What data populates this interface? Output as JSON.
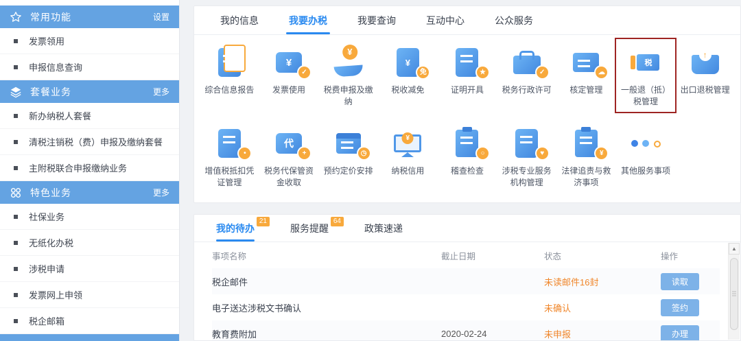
{
  "colors": {
    "section_header_blue": "#64a3e2",
    "active_tab_blue": "#2a8af0",
    "icon_blue": "#4f97e8",
    "icon_orange": "#f8a93c",
    "status_orange": "#f0862a",
    "button_blue": "#7db2e8",
    "highlight_box_red": "#9e2422"
  },
  "sidebar": {
    "sections": [
      {
        "title": "常用功能",
        "action": "设置",
        "icon": "star-icon",
        "items": [
          {
            "label": "发票领用"
          },
          {
            "label": "申报信息查询"
          }
        ]
      },
      {
        "title": "套餐业务",
        "action": "更多",
        "icon": "layers-icon",
        "items": [
          {
            "label": "新办纳税人套餐"
          },
          {
            "label": "清税注销税（费）申报及缴纳套餐"
          },
          {
            "label": "主附税联合申报缴纳业务"
          }
        ]
      },
      {
        "title": "特色业务",
        "action": "更多",
        "icon": "grid-dots-icon",
        "items": [
          {
            "label": "社保业务"
          },
          {
            "label": "无纸化办税"
          },
          {
            "label": "涉税申请"
          },
          {
            "label": "发票网上申领"
          },
          {
            "label": "税企邮箱"
          }
        ]
      }
    ]
  },
  "top_tabs": [
    {
      "label": "我的信息"
    },
    {
      "label": "我要办税",
      "active": true
    },
    {
      "label": "我要查询"
    },
    {
      "label": "互动中心"
    },
    {
      "label": "公众服务"
    }
  ],
  "grid": {
    "row1": [
      {
        "label": "综合信息报告",
        "icon": "stacked-documents-icon"
      },
      {
        "label": "发票使用",
        "icon": "invoice-check-icon",
        "glyph": "¥",
        "badge": "✓"
      },
      {
        "label": "税费申报及缴纳",
        "icon": "hand-coin-icon",
        "badge": "¥"
      },
      {
        "label": "税收减免",
        "icon": "tax-reduction-document-icon",
        "glyph": "¥",
        "badge": "免"
      },
      {
        "label": "证明开具",
        "icon": "certificate-star-icon",
        "badge": "★"
      },
      {
        "label": "税务行政许可",
        "icon": "briefcase-check-icon",
        "badge": "✓"
      },
      {
        "label": "核定管理",
        "icon": "server-cloud-icon",
        "badge": "☁"
      },
      {
        "label": "一般退（抵）税管理",
        "icon": "tax-ticket-icon",
        "glyph": "税",
        "highlighted": true
      },
      {
        "label": "出口退税管理",
        "icon": "export-box-icon",
        "glyph": "↑"
      }
    ],
    "row2": [
      {
        "label": "增值税抵扣凭证管理",
        "icon": "document-stamp-icon",
        "badge": "•"
      },
      {
        "label": "税务代保管资金收取",
        "icon": "agent-bubble-icon",
        "glyph": "代",
        "badge": "+"
      },
      {
        "label": "预约定价安排",
        "icon": "calendar-clock-icon",
        "badge": "◷"
      },
      {
        "label": "纳税信用",
        "icon": "monitor-coin-icon",
        "badge": "¥"
      },
      {
        "label": "稽查检查",
        "icon": "clipboard-search-icon",
        "badge": "○"
      },
      {
        "label": "涉税专业服务机构管理",
        "icon": "document-heart-icon",
        "badge": "♥"
      },
      {
        "label": "法律追责与救济事项",
        "icon": "clipboard-law-icon",
        "badge": "¥"
      },
      {
        "label": "其他服务事项",
        "icon": "ellipsis-dots-icon"
      }
    ]
  },
  "todo": {
    "tabs": [
      {
        "label": "我的待办",
        "badge": "21",
        "active": true
      },
      {
        "label": "服务提醒",
        "badge": "64"
      },
      {
        "label": "政策速递"
      }
    ],
    "columns": [
      "事项名称",
      "截止日期",
      "状态",
      "操作"
    ],
    "rows": [
      {
        "name": "税企邮件",
        "due": "",
        "status": "未读邮件16封",
        "action": "读取"
      },
      {
        "name": "电子送达涉税文书确认",
        "due": "",
        "status": "未确认",
        "action": "签约"
      },
      {
        "name": "教育费附加",
        "due": "2020-02-24",
        "status": "未申报",
        "action": "办理"
      }
    ]
  }
}
